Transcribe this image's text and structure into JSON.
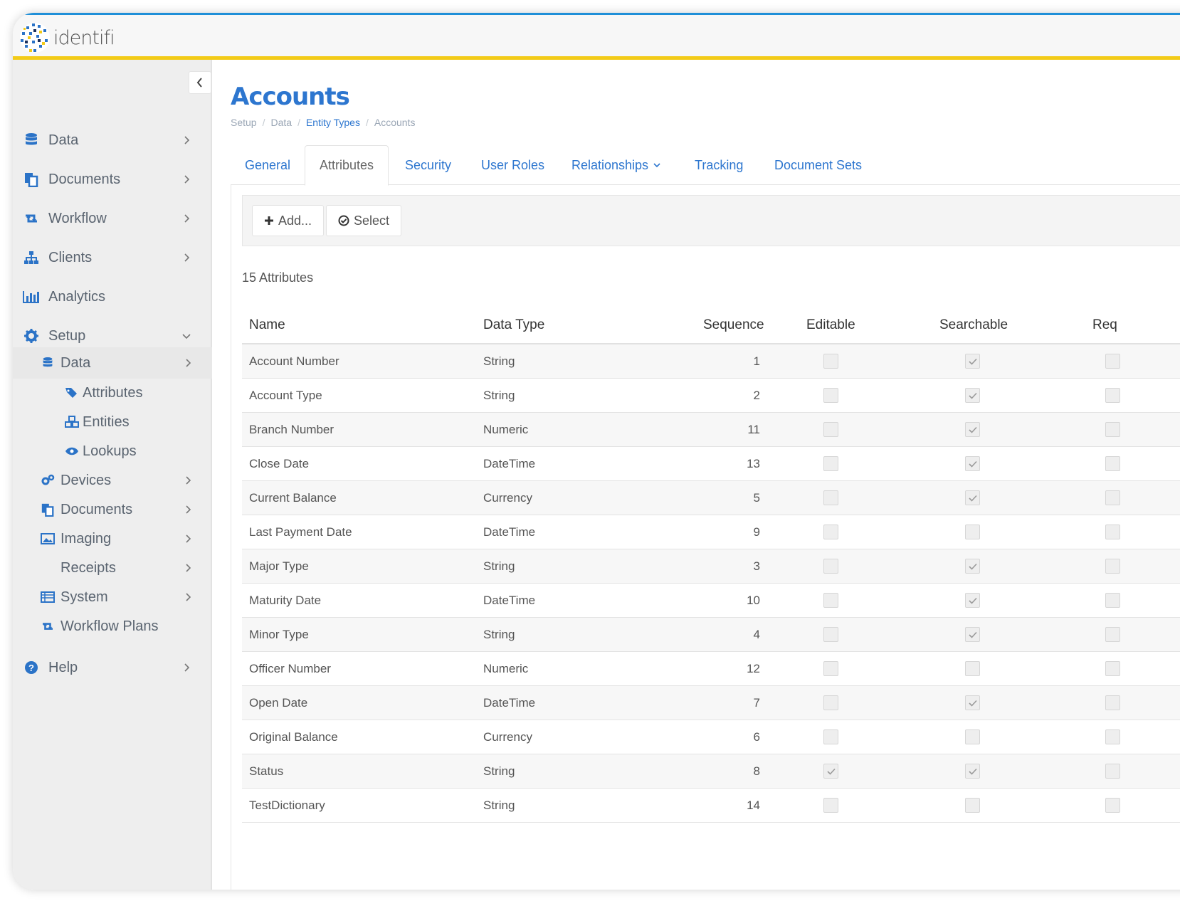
{
  "app": {
    "logo_text": "identifi"
  },
  "sidebar": {
    "items": [
      {
        "label": "Data",
        "icon": "database-icon"
      },
      {
        "label": "Documents",
        "icon": "documents-icon"
      },
      {
        "label": "Workflow",
        "icon": "retweet-icon"
      },
      {
        "label": "Clients",
        "icon": "sitemap-icon"
      },
      {
        "label": "Analytics",
        "icon": "bar-chart-icon"
      },
      {
        "label": "Setup",
        "icon": "gear-icon"
      }
    ],
    "setup_children": [
      {
        "label": "Data",
        "icon": "database-icon"
      },
      {
        "label": "Devices",
        "icon": "cogs-icon"
      },
      {
        "label": "Documents",
        "icon": "documents-icon"
      },
      {
        "label": "Imaging",
        "icon": "image-icon"
      },
      {
        "label": "Receipts",
        "icon": ""
      },
      {
        "label": "System",
        "icon": "list-icon"
      },
      {
        "label": "Workflow Plans",
        "icon": "retweet-icon"
      }
    ],
    "data_children": [
      {
        "label": "Attributes",
        "icon": "tags-icon"
      },
      {
        "label": "Entities",
        "icon": "cubes-icon"
      },
      {
        "label": "Lookups",
        "icon": "eye-icon"
      }
    ],
    "help": {
      "label": "Help",
      "icon": "question-circle-icon"
    }
  },
  "page": {
    "title": "Accounts",
    "breadcrumb": [
      "Setup",
      "Data",
      "Entity Types",
      "Accounts"
    ]
  },
  "tabs": [
    "General",
    "Attributes",
    "Security",
    "User Roles",
    "Relationships",
    "Tracking",
    "Document Sets"
  ],
  "toolbar": {
    "add_label": "Add...",
    "select_label": "Select"
  },
  "attributes_count": "15 Attributes",
  "table": {
    "headers": [
      "Name",
      "Data Type",
      "Sequence",
      "Editable",
      "Searchable",
      "Req"
    ],
    "rows": [
      {
        "name": "Account Number",
        "type": "String",
        "seq": "1",
        "editable": false,
        "searchable": true
      },
      {
        "name": "Account Type",
        "type": "String",
        "seq": "2",
        "editable": false,
        "searchable": true
      },
      {
        "name": "Branch Number",
        "type": "Numeric",
        "seq": "11",
        "editable": false,
        "searchable": true
      },
      {
        "name": "Close Date",
        "type": "DateTime",
        "seq": "13",
        "editable": false,
        "searchable": true
      },
      {
        "name": "Current Balance",
        "type": "Currency",
        "seq": "5",
        "editable": false,
        "searchable": true
      },
      {
        "name": "Last Payment Date",
        "type": "DateTime",
        "seq": "9",
        "editable": false,
        "searchable": false
      },
      {
        "name": "Major Type",
        "type": "String",
        "seq": "3",
        "editable": false,
        "searchable": true
      },
      {
        "name": "Maturity Date",
        "type": "DateTime",
        "seq": "10",
        "editable": false,
        "searchable": true
      },
      {
        "name": "Minor Type",
        "type": "String",
        "seq": "4",
        "editable": false,
        "searchable": true
      },
      {
        "name": "Officer Number",
        "type": "Numeric",
        "seq": "12",
        "editable": false,
        "searchable": false
      },
      {
        "name": "Open Date",
        "type": "DateTime",
        "seq": "7",
        "editable": false,
        "searchable": true
      },
      {
        "name": "Original Balance",
        "type": "Currency",
        "seq": "6",
        "editable": false,
        "searchable": false
      },
      {
        "name": "Status",
        "type": "String",
        "seq": "8",
        "editable": true,
        "searchable": true
      },
      {
        "name": "TestDictionary",
        "type": "String",
        "seq": "14",
        "editable": false,
        "searchable": false
      }
    ]
  },
  "colors": {
    "accent": "#2d76cf",
    "top_border": "#1f8fd8",
    "header_stripe": "#f3cb18"
  }
}
